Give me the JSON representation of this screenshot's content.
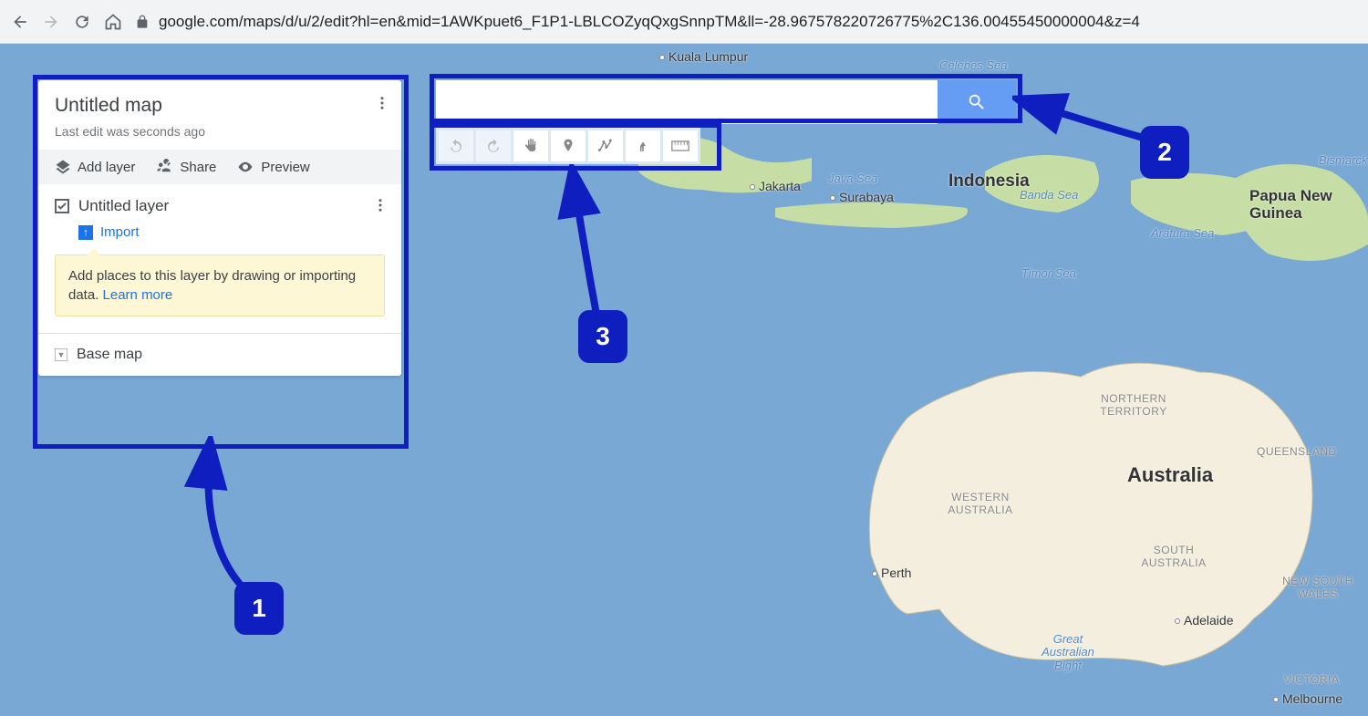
{
  "browser": {
    "url": "google.com/maps/d/u/2/edit?hl=en&mid=1AWKpuet6_F1P1-LBLCOZyqQxgSnnpTM&ll=-28.967578220726775%2C136.00455450000004&z=4"
  },
  "panel": {
    "title": "Untitled map",
    "subtitle": "Last edit was seconds ago",
    "actions": {
      "add_layer": "Add layer",
      "share": "Share",
      "preview": "Preview"
    },
    "layer": {
      "title": "Untitled layer",
      "import": "Import",
      "tooltip_text": "Add places to this layer by drawing or importing data. ",
      "tooltip_link": "Learn more"
    },
    "basemap": "Base map"
  },
  "search": {
    "placeholder": ""
  },
  "callouts": {
    "n1": "1",
    "n2": "2",
    "n3": "3"
  },
  "map_labels": {
    "kuala_lumpur": "Kuala Lumpur",
    "celebes_sea": "Celebes Sea",
    "jakarta": "Jakarta",
    "java_sea": "Java Sea",
    "surabaya": "Surabaya",
    "indonesia": "Indonesia",
    "banda_sea": "Banda Sea",
    "bismarck": "Bismarck",
    "png": "Papua New Guinea",
    "arafura": "Arafura Sea",
    "timor": "Timor Sea",
    "nt": "NORTHERN TERRITORY",
    "queensland": "QUEENSLAND",
    "wa": "WESTERN AUSTRALIA",
    "sa": "SOUTH AUSTRALIA",
    "nsw": "NEW SOUTH WALES",
    "victoria": "VICTORIA",
    "australia": "Australia",
    "perth": "Perth",
    "adelaide": "Adelaide",
    "melbourne": "Melbourne",
    "gab": "Great Australian Bight"
  }
}
